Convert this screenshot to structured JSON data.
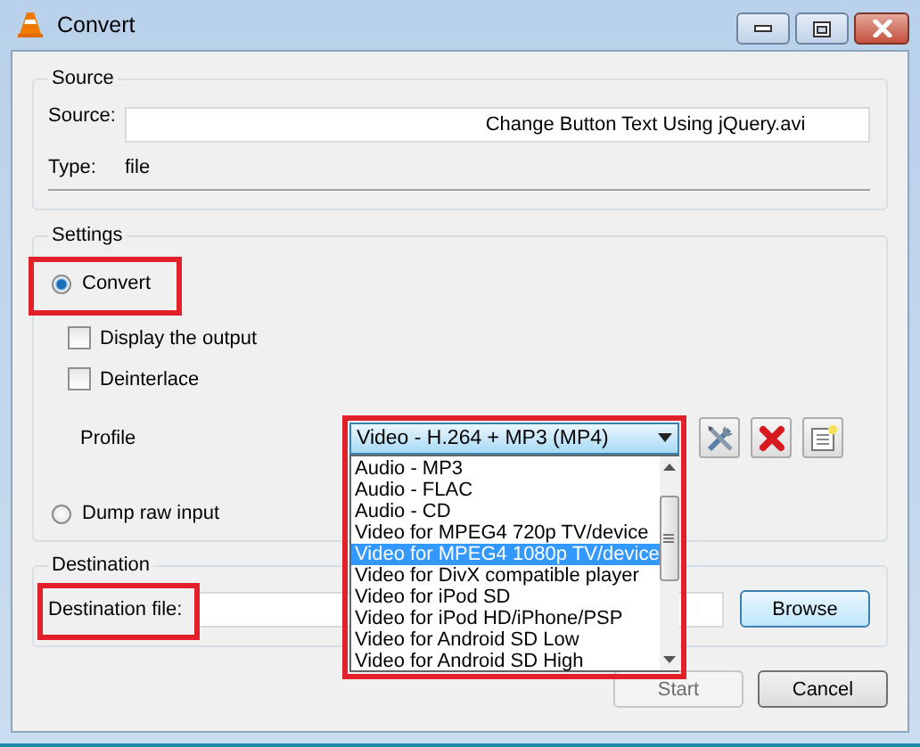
{
  "window": {
    "title": "Convert"
  },
  "source": {
    "legend": "Source",
    "label": "Source:",
    "value": "Change Button Text Using jQuery.avi",
    "type_label": "Type:",
    "type_value": "file"
  },
  "settings": {
    "legend": "Settings",
    "modes": [
      {
        "label": "Convert",
        "selected": true,
        "highlighted": true
      },
      {
        "label": "Dump raw input",
        "selected": false,
        "highlighted": false
      }
    ],
    "options": [
      {
        "label": "Display the output",
        "checked": false
      },
      {
        "label": "Deinterlace",
        "checked": false
      }
    ],
    "profile": {
      "label": "Profile",
      "value": "Video - H.264 + MP3 (MP4)",
      "expanded": true,
      "highlighted": true,
      "items": [
        {
          "label": "Audio - MP3",
          "selected": false
        },
        {
          "label": "Audio - FLAC",
          "selected": false
        },
        {
          "label": "Audio - CD",
          "selected": false
        },
        {
          "label": "Video for MPEG4 720p TV/device",
          "selected": false
        },
        {
          "label": "Video for MPEG4 1080p TV/device",
          "selected": true
        },
        {
          "label": "Video for DivX compatible player",
          "selected": false
        },
        {
          "label": "Video for iPod SD",
          "selected": false
        },
        {
          "label": "Video for iPod HD/iPhone/PSP",
          "selected": false
        },
        {
          "label": "Video for Android SD Low",
          "selected": false
        },
        {
          "label": "Video for Android SD High",
          "selected": false
        }
      ]
    }
  },
  "destination": {
    "legend": "Destination",
    "label": "Destination file:",
    "label_highlighted": true,
    "browse": "Browse"
  },
  "buttons": [
    {
      "label": "Start",
      "disabled": true
    },
    {
      "label": "Cancel",
      "disabled": false
    }
  ]
}
